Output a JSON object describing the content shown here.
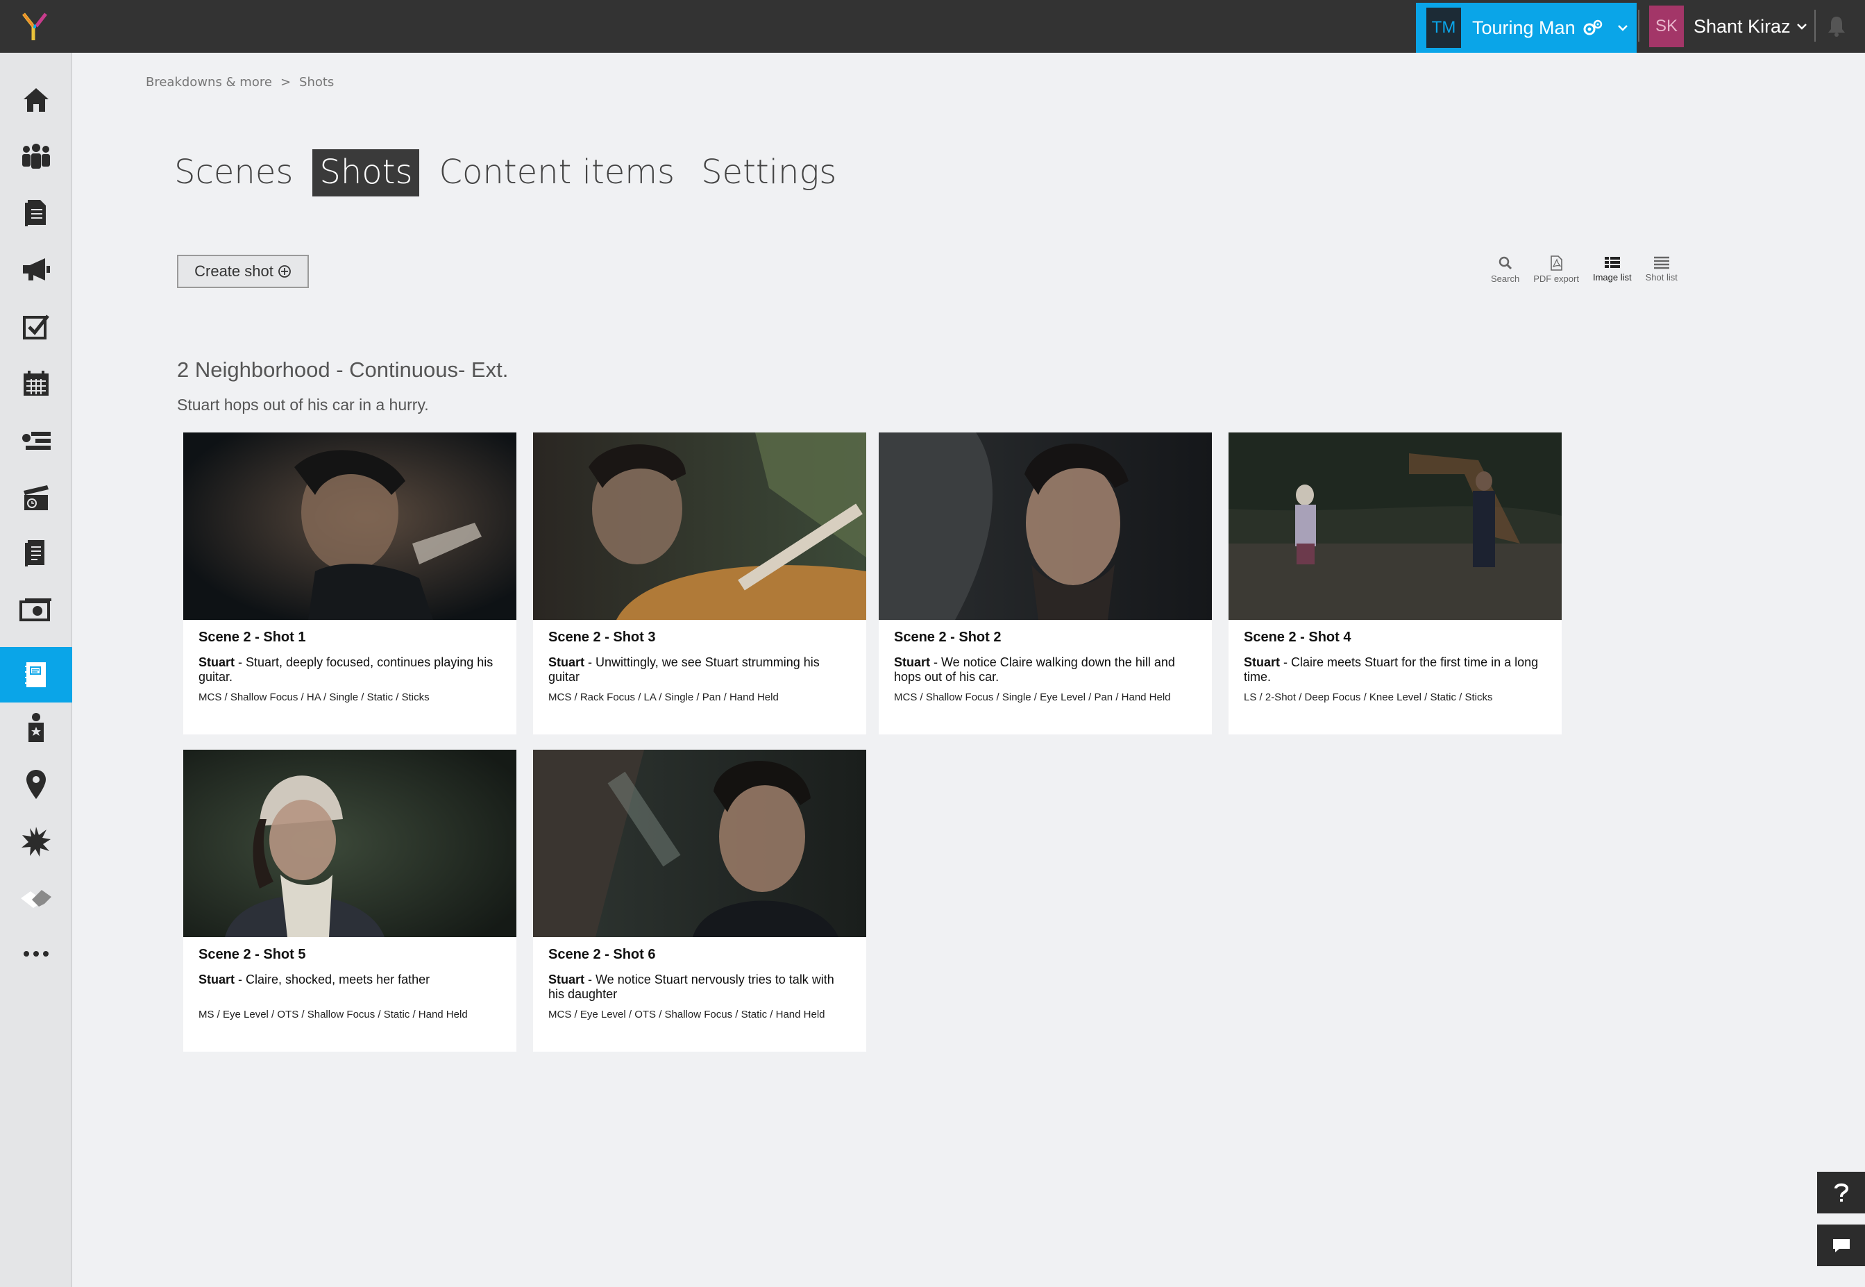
{
  "header": {
    "project_initials": "TM",
    "project_name": "Touring Man",
    "user_initials": "SK",
    "user_name": "Shant Kiraz"
  },
  "sidebar": {
    "items": [
      {
        "icon": "home-icon"
      },
      {
        "icon": "people-icon"
      },
      {
        "icon": "document-icon"
      },
      {
        "icon": "megaphone-icon"
      },
      {
        "icon": "checkbox-icon"
      },
      {
        "icon": "calendar-icon"
      },
      {
        "icon": "stripboard-icon"
      },
      {
        "icon": "clapperboard-icon"
      },
      {
        "icon": "script-icon"
      },
      {
        "icon": "money-icon"
      },
      {
        "icon": "breakdown-icon",
        "active": true
      },
      {
        "icon": "cast-icon"
      },
      {
        "icon": "location-icon"
      },
      {
        "icon": "effects-icon"
      },
      {
        "icon": "handshake-icon"
      },
      {
        "icon": "more-icon"
      }
    ]
  },
  "breadcrumb": {
    "parent": "Breakdowns & more",
    "separator": ">",
    "current": "Shots"
  },
  "tabs": [
    {
      "label": "Scenes",
      "active": false
    },
    {
      "label": "Shots",
      "active": true
    },
    {
      "label": "Content items",
      "active": false
    },
    {
      "label": "Settings",
      "active": false
    }
  ],
  "toolbar": {
    "create_label": "Create shot",
    "tools": [
      {
        "label": "Search",
        "icon": "search-icon"
      },
      {
        "label": "PDF export",
        "icon": "pdf-icon"
      },
      {
        "label": "Image list",
        "icon": "image-list-icon",
        "active": true
      },
      {
        "label": "Shot list",
        "icon": "shot-list-icon"
      }
    ]
  },
  "scene": {
    "title": "2 Neighborhood - Continuous- Ext.",
    "description": "Stuart hops out of his car in a hurry."
  },
  "shots": [
    {
      "title": "Scene 2 - Shot 1",
      "character": "Stuart",
      "description": " - Stuart, deeply focused, continues playing his guitar.",
      "tags": "MCS / Shallow Focus / HA / Single / Static / Sticks"
    },
    {
      "title": "Scene 2 - Shot 3",
      "character": "Stuart",
      "description": " - Unwittingly, we see Stuart strumming his guitar",
      "tags": "MCS / Rack Focus / LA / Single / Pan / Hand Held"
    },
    {
      "title": "Scene 2 - Shot 2",
      "character": "Stuart",
      "description": " - We notice Claire walking down the hill and hops out of his car.",
      "tags": "MCS / Shallow Focus / Single / Eye Level / Pan / Hand Held"
    },
    {
      "title": "Scene 2 - Shot 4",
      "character": "Stuart",
      "description": " - Claire meets Stuart for the first time in a long time.",
      "tags": "LS / 2-Shot / Deep Focus / Knee Level / Static / Sticks"
    },
    {
      "title": "Scene 2 - Shot 5",
      "character": "Stuart",
      "description": " - Claire, shocked, meets her father",
      "tags": "MS / Eye Level / OTS / Shallow Focus / Static / Hand Held"
    },
    {
      "title": "Scene 2 - Shot 6",
      "character": "Stuart",
      "description": " - We notice Stuart nervously tries to talk with his daughter",
      "tags": "MCS / Eye Level / OTS / Shallow Focus / Static / Hand Held"
    }
  ],
  "colors": {
    "accent": "#0aa5e8",
    "topbar": "#333333",
    "user_avatar": "#a33668"
  }
}
